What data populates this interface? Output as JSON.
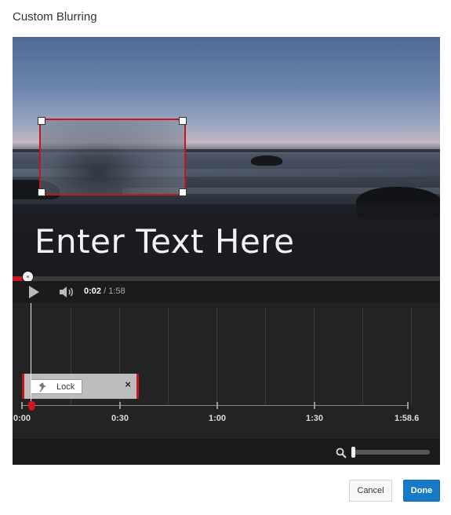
{
  "dialog": {
    "title": "Custom Blurring"
  },
  "video": {
    "overlay_text": "Enter Text Here",
    "played_fraction": 0.017
  },
  "controls": {
    "play_icon": "play-icon",
    "volume_icon": "volume-icon",
    "current_time": "0:02",
    "separator": " / ",
    "duration": "1:58"
  },
  "timeline": {
    "segment": {
      "lock_label": "Lock",
      "close_glyph": "×"
    },
    "ticks": [
      "0:00",
      "0:30",
      "1:00",
      "1:30",
      "1:58.6"
    ]
  },
  "zoom": {
    "icon": "magnifier-icon",
    "level": 0
  },
  "buttons": {
    "cancel": "Cancel",
    "done": "Done"
  },
  "colors": {
    "accent_red": "#cc181e",
    "primary_blue": "#167ac6"
  }
}
